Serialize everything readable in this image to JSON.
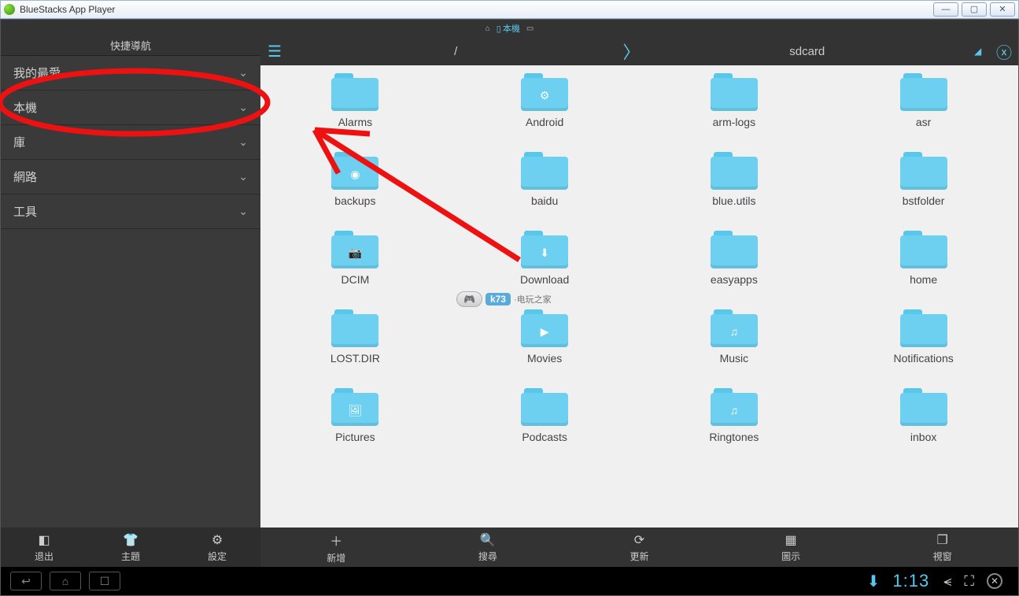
{
  "window": {
    "title": "BlueStacks App Player"
  },
  "tabstrip": {
    "home_icon": "⌂",
    "device_label": "本機",
    "extra_icon": "▭"
  },
  "sidebar": {
    "title": "快捷導航",
    "items": [
      {
        "label": "我的最愛"
      },
      {
        "label": "本機"
      },
      {
        "label": "庫"
      },
      {
        "label": "網路"
      },
      {
        "label": "工具"
      }
    ]
  },
  "pathbar": {
    "root": "/",
    "current": "sdcard"
  },
  "folders": [
    {
      "label": "Alarms",
      "badge": ""
    },
    {
      "label": "Android",
      "badge": "⚙"
    },
    {
      "label": "arm-logs",
      "badge": ""
    },
    {
      "label": "asr",
      "badge": ""
    },
    {
      "label": "backups",
      "badge": "◉"
    },
    {
      "label": "baidu",
      "badge": ""
    },
    {
      "label": "blue.utils",
      "badge": ""
    },
    {
      "label": "bstfolder",
      "badge": ""
    },
    {
      "label": "DCIM",
      "badge": "📷"
    },
    {
      "label": "Download",
      "badge": "⬇"
    },
    {
      "label": "easyapps",
      "badge": ""
    },
    {
      "label": "home",
      "badge": ""
    },
    {
      "label": "LOST.DIR",
      "badge": ""
    },
    {
      "label": "Movies",
      "badge": "▶"
    },
    {
      "label": "Music",
      "badge": "♫"
    },
    {
      "label": "Notifications",
      "badge": ""
    },
    {
      "label": "Pictures",
      "badge": "🖼"
    },
    {
      "label": "Podcasts",
      "badge": ""
    },
    {
      "label": "Ringtones",
      "badge": "♫"
    },
    {
      "label": "inbox",
      "badge": ""
    }
  ],
  "toolbar_left": [
    {
      "icon": "◧",
      "label": "退出"
    },
    {
      "icon": "👕",
      "label": "主題"
    },
    {
      "icon": "⚙",
      "label": "設定"
    }
  ],
  "toolbar_right": [
    {
      "icon": "＋",
      "label": "新增"
    },
    {
      "icon": "🔍",
      "label": "搜尋"
    },
    {
      "icon": "⟳",
      "label": "更新"
    },
    {
      "icon": "▦",
      "label": "圖示"
    },
    {
      "icon": "❐",
      "label": "視窗"
    }
  ],
  "navbar": {
    "clock": "1:13"
  },
  "watermark": {
    "brand": "k73",
    "suffix": "·电玩之家"
  }
}
